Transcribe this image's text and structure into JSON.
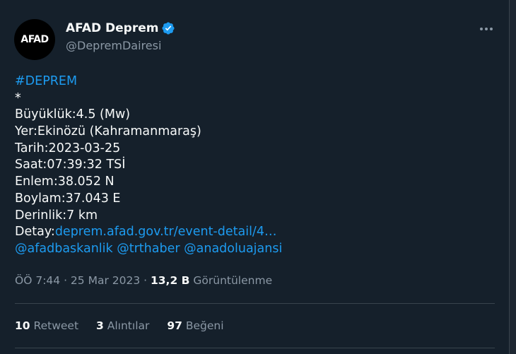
{
  "author": {
    "avatar_text": "AFAD",
    "name": "AFAD Deprem",
    "handle": "@DepremDairesi"
  },
  "tweet": {
    "hashtag": "#DEPREM",
    "star": "*",
    "magnitude": "Büyüklük:4.5 (Mw)",
    "location": "Yer:Ekinözü (Kahramanmaraş)",
    "date": "Tarih:2023-03-25",
    "time": "Saat:07:39:32 TSİ",
    "latitude": "Enlem:38.052 N",
    "longitude": "Boylam:37.043 E",
    "depth": "Derinlik:7 km",
    "detail_label": "Detay:",
    "detail_link": "deprem.afad.gov.tr/event-detail/4…",
    "mention_1": "@afadbaskanlik",
    "mention_2": "@trthaber",
    "mention_3": "@anadoluajansi"
  },
  "meta": {
    "time": "ÖÖ 7:44",
    "separator": " · ",
    "date": "25 Mar 2023",
    "views_count": "13,2 B",
    "views_label": "Görüntülenme"
  },
  "stats": {
    "retweets_count": "10",
    "retweets_label": "Retweet",
    "quotes_count": "3",
    "quotes_label": "Alıntılar",
    "likes_count": "97",
    "likes_label": "Beğeni"
  },
  "colors": {
    "background": "#15202b",
    "link": "#1d9bf0",
    "muted": "#8b98a5",
    "verified": "#1d9bf0"
  }
}
